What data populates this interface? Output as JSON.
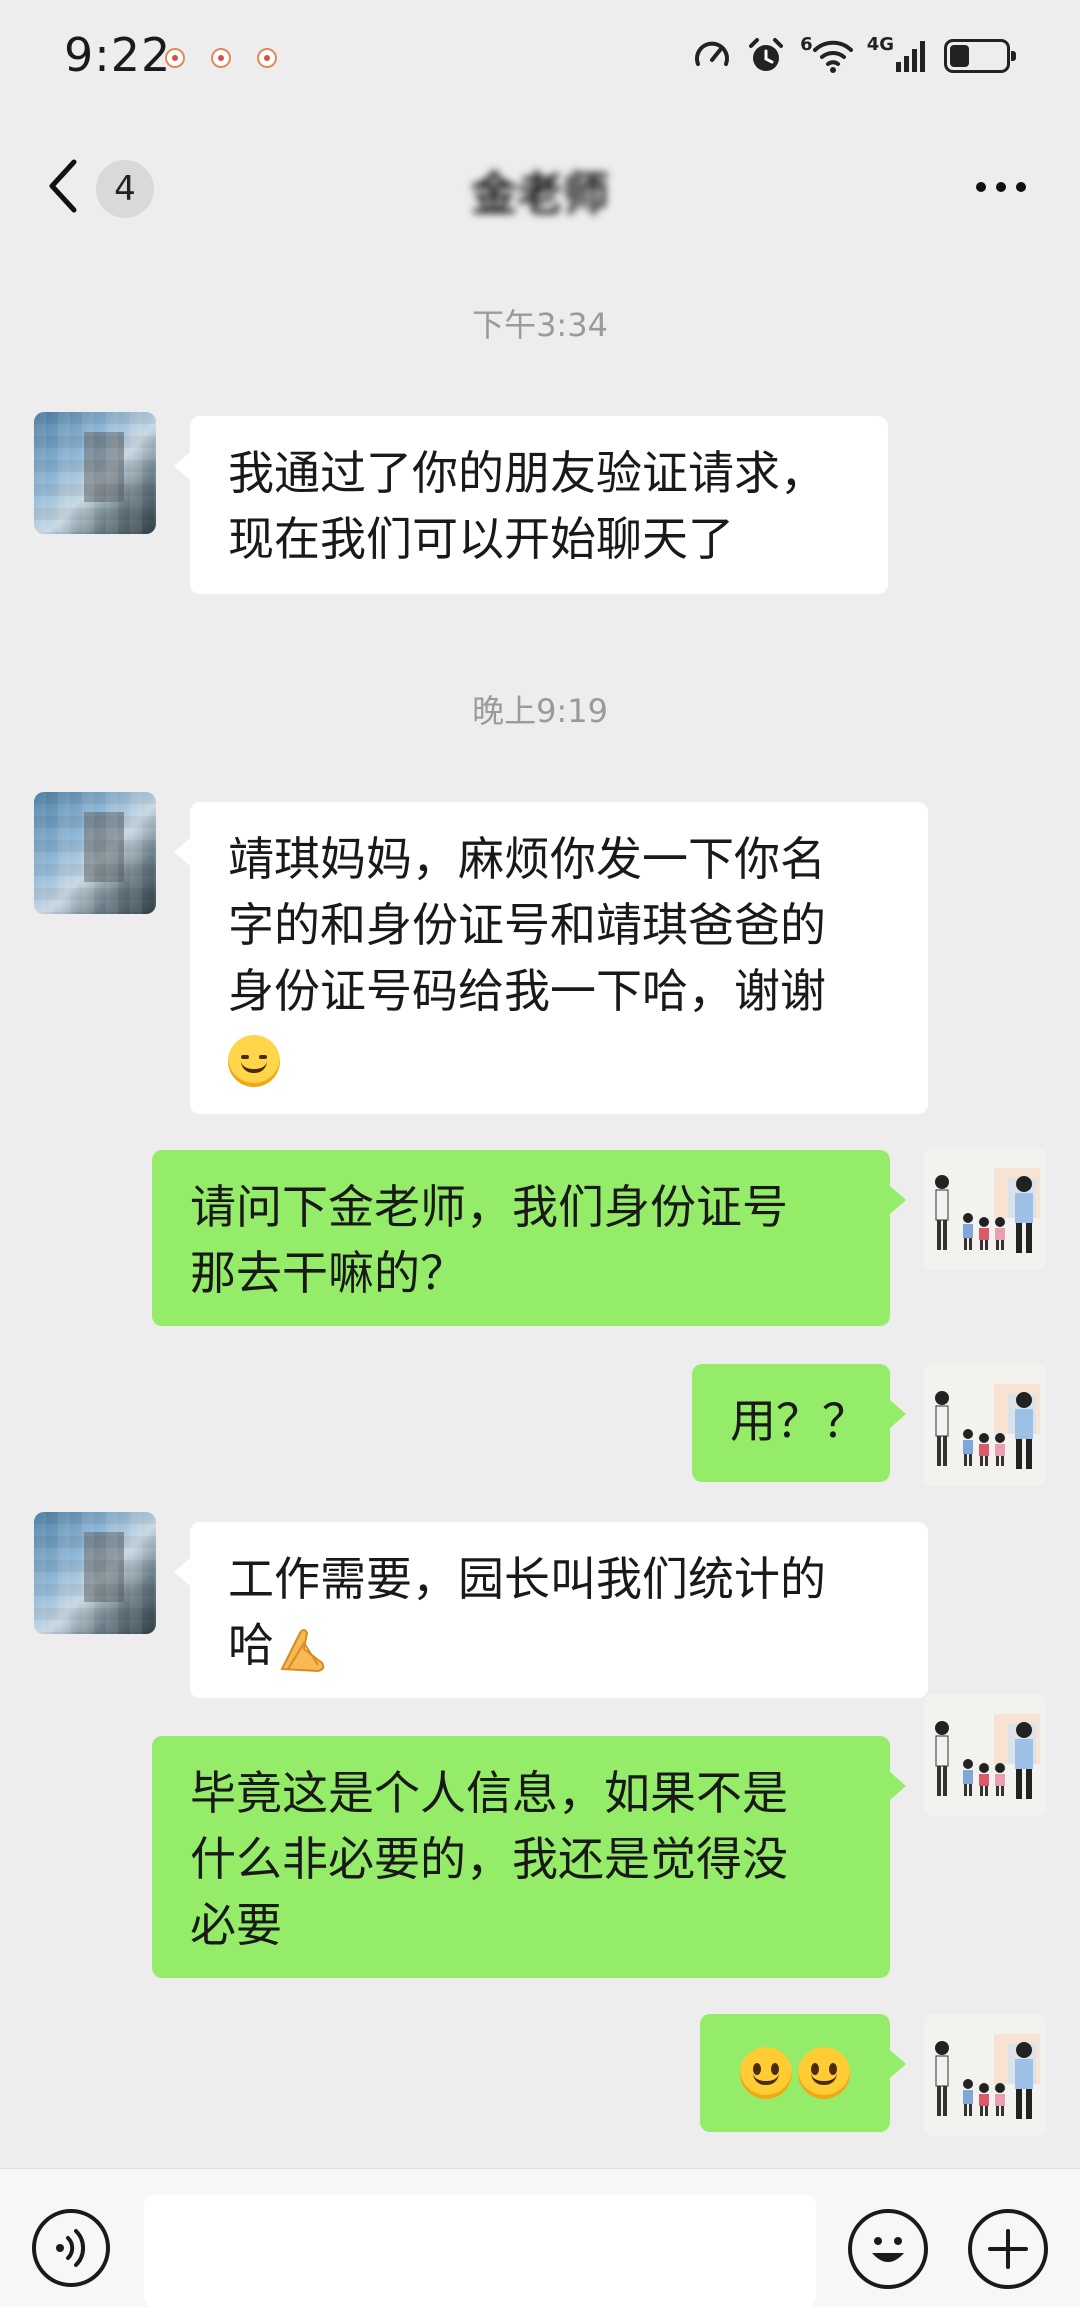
{
  "status_bar": {
    "time": "9:22",
    "network_label": "4G",
    "wifi_label": "6",
    "battery_level": 0.35
  },
  "header": {
    "unread_count": "4",
    "title": "金老师"
  },
  "messages": [
    {
      "type": "timestamp",
      "text": "下午3:34"
    },
    {
      "type": "incoming",
      "lines": [
        "我通过了你的朋友验证请求，",
        "现在我们可以开始聊天了"
      ]
    },
    {
      "type": "timestamp",
      "text": "晚上9:19"
    },
    {
      "type": "incoming",
      "lines": [
        "靖琪妈妈，麻烦你发一下你名",
        "字的和身份证号和靖琪爸爸的",
        "身份证号码给我一下哈，谢谢"
      ],
      "trailing_emoji": "blush-smile-emoji"
    },
    {
      "type": "outgoing",
      "lines": [
        "请问下金老师，我们身份证号",
        "那去干嘛的？"
      ]
    },
    {
      "type": "outgoing",
      "lines": [
        "用？？"
      ]
    },
    {
      "type": "incoming",
      "lines": [
        "工作需要，园长叫我们统计的",
        "哈"
      ],
      "trailing_emoji": "folded-hands-emoji"
    },
    {
      "type": "outgoing",
      "lines": [
        "毕竟这是个人信息，如果不是",
        "什么非必要的，我还是觉得没",
        "必要"
      ]
    },
    {
      "type": "outgoing",
      "emojis": [
        "smile-emoji",
        "smile-emoji"
      ]
    }
  ],
  "input_bar": {
    "placeholder": "",
    "icons": [
      "voice-icon",
      "emoji-icon",
      "plus-icon"
    ]
  },
  "colors": {
    "background": "#ededed",
    "incoming_bubble": "#ffffff",
    "outgoing_bubble": "#95ec69",
    "timestamp_text": "#9a9a9a"
  }
}
